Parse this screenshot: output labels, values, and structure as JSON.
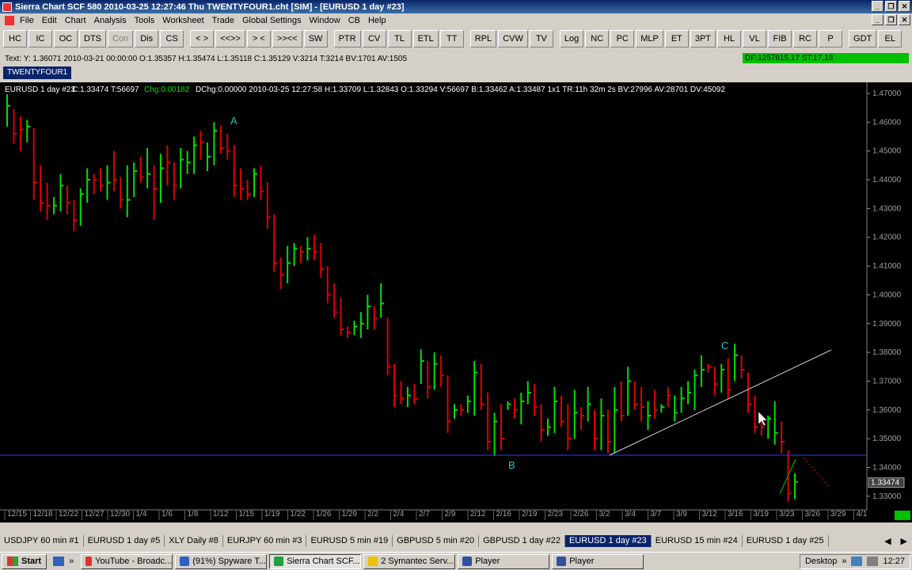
{
  "window": {
    "title": "Sierra Chart SCF 580  2010-03-25  12:27:46  Thu   TWENTYFOUR1.cht [SIM] - [EURUSD  1 day  #23]"
  },
  "menu": [
    "File",
    "Edit",
    "Chart",
    "Analysis",
    "Tools",
    "Worksheet",
    "Trade",
    "Global Settings",
    "Window",
    "CB",
    "Help"
  ],
  "toolbar": [
    "HC",
    "IC",
    "OC",
    "DTS",
    "Con",
    "Dis",
    "CS",
    "< >",
    "<<>>",
    "> <",
    ">><<",
    "SW",
    "PTR",
    "CV",
    "TL",
    "ETL",
    "TT",
    "RPL",
    "CVW",
    "TV",
    "Log",
    "NC",
    "PC",
    "MLP",
    "ET",
    "3PT",
    "HL",
    "VL",
    "FIB",
    "RC",
    "P",
    "GDT",
    "EL"
  ],
  "status": {
    "text": "Text: Y: 1.36071  2010-03-21  00:00:00  O:1.35357  H:1.35474  L:1.35118  C:1.35129  V:3214  T:3214  BV:1701  AV:1505",
    "df": "DF:1257815,17  ST:17,18"
  },
  "chartbook_tab": "TWENTYFOUR1",
  "chart_header": {
    "symbol": "EURUSD  1 day  #23",
    "close": "C:1.33474",
    "t": "T:56697",
    "chg": "Chg:0.00182",
    "rest": "DChg:0.00000 2010-03-25 12:27:58 H:1.33709 L:1.32843 O:1.33294 V:56697 B:1.33462 A:1.33487 1x1 TR:11h 32m 2s BV:27996 AV:28701 DV:45092"
  },
  "chart_data": {
    "type": "bar",
    "price_ticks": [
      "1.47000",
      "1.46000",
      "1.45000",
      "1.44000",
      "1.43000",
      "1.42000",
      "1.41000",
      "1.40000",
      "1.39000",
      "1.38000",
      "1.37000",
      "1.36000",
      "1.35000",
      "1.34000",
      "1.33000"
    ],
    "price_range": [
      1.325,
      1.47
    ],
    "date_ticks": [
      "12/15",
      "12/18",
      "12/22",
      "12/27",
      "12/30",
      "1/4",
      "1/6",
      "1/8",
      "1/12",
      "1/15",
      "1/19",
      "1/22",
      "1/26",
      "1/29",
      "2/2",
      "2/4",
      "2/7",
      "2/9",
      "2/12",
      "2/16",
      "2/19",
      "2/23",
      "2/26",
      "3/2",
      "3/4",
      "3/7",
      "3/9",
      "3/12",
      "3/16",
      "3/19",
      "3/23",
      "3/26",
      "3/29",
      "4/1"
    ],
    "last_price": "1.33474",
    "labels": [
      {
        "text": "A"
      },
      {
        "text": "B"
      },
      {
        "text": "C"
      }
    ],
    "up_color": "#00e000",
    "down_color": "#e00000",
    "bars": [
      [
        1.4697,
        1.4585,
        1.4657,
        "u"
      ],
      [
        1.4645,
        1.4525,
        1.456,
        "d"
      ],
      [
        1.462,
        1.45,
        1.4575,
        "d"
      ],
      [
        1.4608,
        1.453,
        1.4585,
        "u"
      ],
      [
        1.458,
        1.433,
        1.439,
        "d"
      ],
      [
        1.445,
        1.429,
        1.432,
        "d"
      ],
      [
        1.439,
        1.426,
        1.431,
        "d"
      ],
      [
        1.434,
        1.428,
        1.431,
        "u"
      ],
      [
        1.442,
        1.429,
        1.438,
        "u"
      ],
      [
        1.438,
        1.428,
        1.432,
        "d"
      ],
      [
        1.433,
        1.422,
        1.426,
        "d"
      ],
      [
        1.437,
        1.424,
        1.435,
        "u"
      ],
      [
        1.444,
        1.432,
        1.44,
        "u"
      ],
      [
        1.442,
        1.435,
        1.44,
        "d"
      ],
      [
        1.444,
        1.436,
        1.438,
        "d"
      ],
      [
        1.445,
        1.433,
        1.439,
        "u"
      ],
      [
        1.45,
        1.436,
        1.44,
        "d"
      ],
      [
        1.441,
        1.43,
        1.433,
        "d"
      ],
      [
        1.445,
        1.427,
        1.433,
        "u"
      ],
      [
        1.446,
        1.434,
        1.443,
        "u"
      ],
      [
        1.448,
        1.439,
        1.441,
        "d"
      ],
      [
        1.451,
        1.437,
        1.442,
        "u"
      ],
      [
        1.445,
        1.426,
        1.437,
        "d"
      ],
      [
        1.449,
        1.432,
        1.444,
        "u"
      ],
      [
        1.452,
        1.438,
        1.446,
        "d"
      ],
      [
        1.446,
        1.433,
        1.438,
        "d"
      ],
      [
        1.451,
        1.437,
        1.447,
        "u"
      ],
      [
        1.45,
        1.442,
        1.446,
        "u"
      ],
      [
        1.455,
        1.442,
        1.452,
        "u"
      ],
      [
        1.457,
        1.447,
        1.453,
        "d"
      ],
      [
        1.453,
        1.443,
        1.448,
        "u"
      ],
      [
        1.46,
        1.445,
        1.457,
        "u"
      ],
      [
        1.459,
        1.449,
        1.451,
        "d"
      ],
      [
        1.456,
        1.447,
        1.45,
        "d"
      ],
      [
        1.452,
        1.434,
        1.438,
        "d"
      ],
      [
        1.444,
        1.433,
        1.437,
        "d"
      ],
      [
        1.44,
        1.433,
        1.435,
        "d"
      ],
      [
        1.444,
        1.434,
        1.442,
        "u"
      ],
      [
        1.445,
        1.433,
        1.436,
        "d"
      ],
      [
        1.439,
        1.423,
        1.427,
        "d"
      ],
      [
        1.428,
        1.408,
        1.411,
        "d"
      ],
      [
        1.413,
        1.402,
        1.407,
        "d"
      ],
      [
        1.417,
        1.404,
        1.411,
        "u"
      ],
      [
        1.418,
        1.41,
        1.416,
        "u"
      ],
      [
        1.417,
        1.411,
        1.415,
        "d"
      ],
      [
        1.42,
        1.412,
        1.416,
        "u"
      ],
      [
        1.421,
        1.412,
        1.415,
        "d"
      ],
      [
        1.418,
        1.406,
        1.409,
        "d"
      ],
      [
        1.41,
        1.397,
        1.4,
        "d"
      ],
      [
        1.404,
        1.392,
        1.394,
        "d"
      ],
      [
        1.399,
        1.386,
        1.388,
        "d"
      ],
      [
        1.389,
        1.385,
        1.387,
        "d"
      ],
      [
        1.391,
        1.386,
        1.389,
        "u"
      ],
      [
        1.394,
        1.385,
        1.39,
        "u"
      ],
      [
        1.4,
        1.388,
        1.396,
        "u"
      ],
      [
        1.396,
        1.388,
        1.392,
        "d"
      ],
      [
        1.404,
        1.392,
        1.397,
        "u"
      ],
      [
        1.392,
        1.372,
        1.375,
        "d"
      ],
      [
        1.376,
        1.361,
        1.365,
        "d"
      ],
      [
        1.37,
        1.362,
        1.364,
        "d"
      ],
      [
        1.368,
        1.361,
        1.365,
        "u"
      ],
      [
        1.369,
        1.362,
        1.364,
        "d"
      ],
      [
        1.381,
        1.369,
        1.377,
        "u"
      ],
      [
        1.377,
        1.364,
        1.368,
        "d"
      ],
      [
        1.38,
        1.367,
        1.376,
        "u"
      ],
      [
        1.379,
        1.368,
        1.372,
        "d"
      ],
      [
        1.372,
        1.352,
        1.356,
        "d"
      ],
      [
        1.362,
        1.357,
        1.36,
        "u"
      ],
      [
        1.362,
        1.358,
        1.36,
        "d"
      ],
      [
        1.365,
        1.359,
        1.363,
        "u"
      ],
      [
        1.377,
        1.358,
        1.373,
        "u"
      ],
      [
        1.376,
        1.36,
        1.362,
        "d"
      ],
      [
        1.366,
        1.346,
        1.349,
        "d"
      ],
      [
        1.359,
        1.344,
        1.356,
        "u"
      ],
      [
        1.362,
        1.346,
        1.35,
        "d"
      ],
      [
        1.363,
        1.36,
        1.362,
        "u"
      ],
      [
        1.364,
        1.357,
        1.36,
        "d"
      ],
      [
        1.366,
        1.355,
        1.363,
        "u"
      ],
      [
        1.37,
        1.362,
        1.366,
        "u"
      ],
      [
        1.369,
        1.358,
        1.361,
        "d"
      ],
      [
        1.362,
        1.349,
        1.353,
        "d"
      ],
      [
        1.357,
        1.351,
        1.354,
        "u"
      ],
      [
        1.368,
        1.352,
        1.363,
        "u"
      ],
      [
        1.365,
        1.354,
        1.356,
        "d"
      ],
      [
        1.362,
        1.346,
        1.35,
        "d"
      ],
      [
        1.367,
        1.35,
        1.359,
        "u"
      ],
      [
        1.361,
        1.353,
        1.358,
        "d"
      ],
      [
        1.368,
        1.356,
        1.362,
        "u"
      ],
      [
        1.36,
        1.346,
        1.35,
        "d"
      ],
      [
        1.364,
        1.346,
        1.358,
        "u"
      ],
      [
        1.36,
        1.345,
        1.349,
        "d"
      ],
      [
        1.368,
        1.345,
        1.36,
        "u"
      ],
      [
        1.37,
        1.356,
        1.358,
        "d"
      ],
      [
        1.375,
        1.358,
        1.37,
        "u"
      ],
      [
        1.37,
        1.36,
        1.362,
        "d"
      ],
      [
        1.368,
        1.356,
        1.361,
        "d"
      ],
      [
        1.363,
        1.353,
        1.358,
        "u"
      ],
      [
        1.367,
        1.357,
        1.36,
        "d"
      ],
      [
        1.362,
        1.359,
        1.361,
        "u"
      ],
      [
        1.368,
        1.361,
        1.365,
        "d"
      ],
      [
        1.365,
        1.356,
        1.359,
        "u"
      ],
      [
        1.368,
        1.359,
        1.364,
        "u"
      ],
      [
        1.37,
        1.362,
        1.366,
        "u"
      ],
      [
        1.374,
        1.36,
        1.372,
        "u"
      ],
      [
        1.379,
        1.368,
        1.374,
        "u"
      ],
      [
        1.376,
        1.373,
        1.375,
        "d"
      ],
      [
        1.375,
        1.365,
        1.369,
        "d"
      ],
      [
        1.376,
        1.366,
        1.374,
        "u"
      ],
      [
        1.378,
        1.364,
        1.367,
        "d"
      ],
      [
        1.383,
        1.37,
        1.379,
        "u"
      ],
      [
        1.379,
        1.371,
        1.374,
        "d"
      ],
      [
        1.373,
        1.359,
        1.362,
        "d"
      ],
      [
        1.365,
        1.352,
        1.354,
        "d"
      ],
      [
        1.357,
        1.351,
        1.354,
        "d"
      ],
      [
        1.358,
        1.35,
        1.357,
        "u"
      ],
      [
        1.363,
        1.348,
        1.352,
        "u"
      ],
      [
        1.356,
        1.345,
        1.349,
        "d"
      ],
      [
        1.346,
        1.328,
        1.331,
        "d"
      ],
      [
        1.338,
        1.329,
        1.335,
        "u"
      ]
    ]
  },
  "sheets": [
    {
      "label": "USDJPY  60 min   #1",
      "active": false
    },
    {
      "label": "EURUSD  1 day   #5",
      "active": false
    },
    {
      "label": "XLY  Daily  #8",
      "active": false
    },
    {
      "label": "EURJPY  60 min   #3",
      "active": false
    },
    {
      "label": "EURUSD  5 min   #19",
      "active": false
    },
    {
      "label": "GBPUSD  5 min   #20",
      "active": false
    },
    {
      "label": "GBPUSD  1 day   #22",
      "active": false
    },
    {
      "label": "EURUSD  1 day   #23",
      "active": true
    },
    {
      "label": "EURUSD  15 min   #24",
      "active": false
    },
    {
      "label": "EURUSD  1 day   #25",
      "active": false
    }
  ],
  "taskbar": {
    "start": "Start",
    "tasks": [
      {
        "label": "YouTube - Broadc...",
        "color": "#e03030",
        "active": false
      },
      {
        "label": "(91%) Spyware T...",
        "color": "#3060c0",
        "active": false
      },
      {
        "label": "Sierra Chart SCF...",
        "color": "#20a040",
        "active": true
      },
      {
        "label": "2 Symantec Serv...",
        "color": "#f0c000",
        "active": false
      },
      {
        "label": "Player",
        "color": "#3050a0",
        "active": false
      },
      {
        "label": "Player",
        "color": "#3050a0",
        "active": false
      }
    ],
    "desktop": "Desktop",
    "clock": "12:27"
  }
}
